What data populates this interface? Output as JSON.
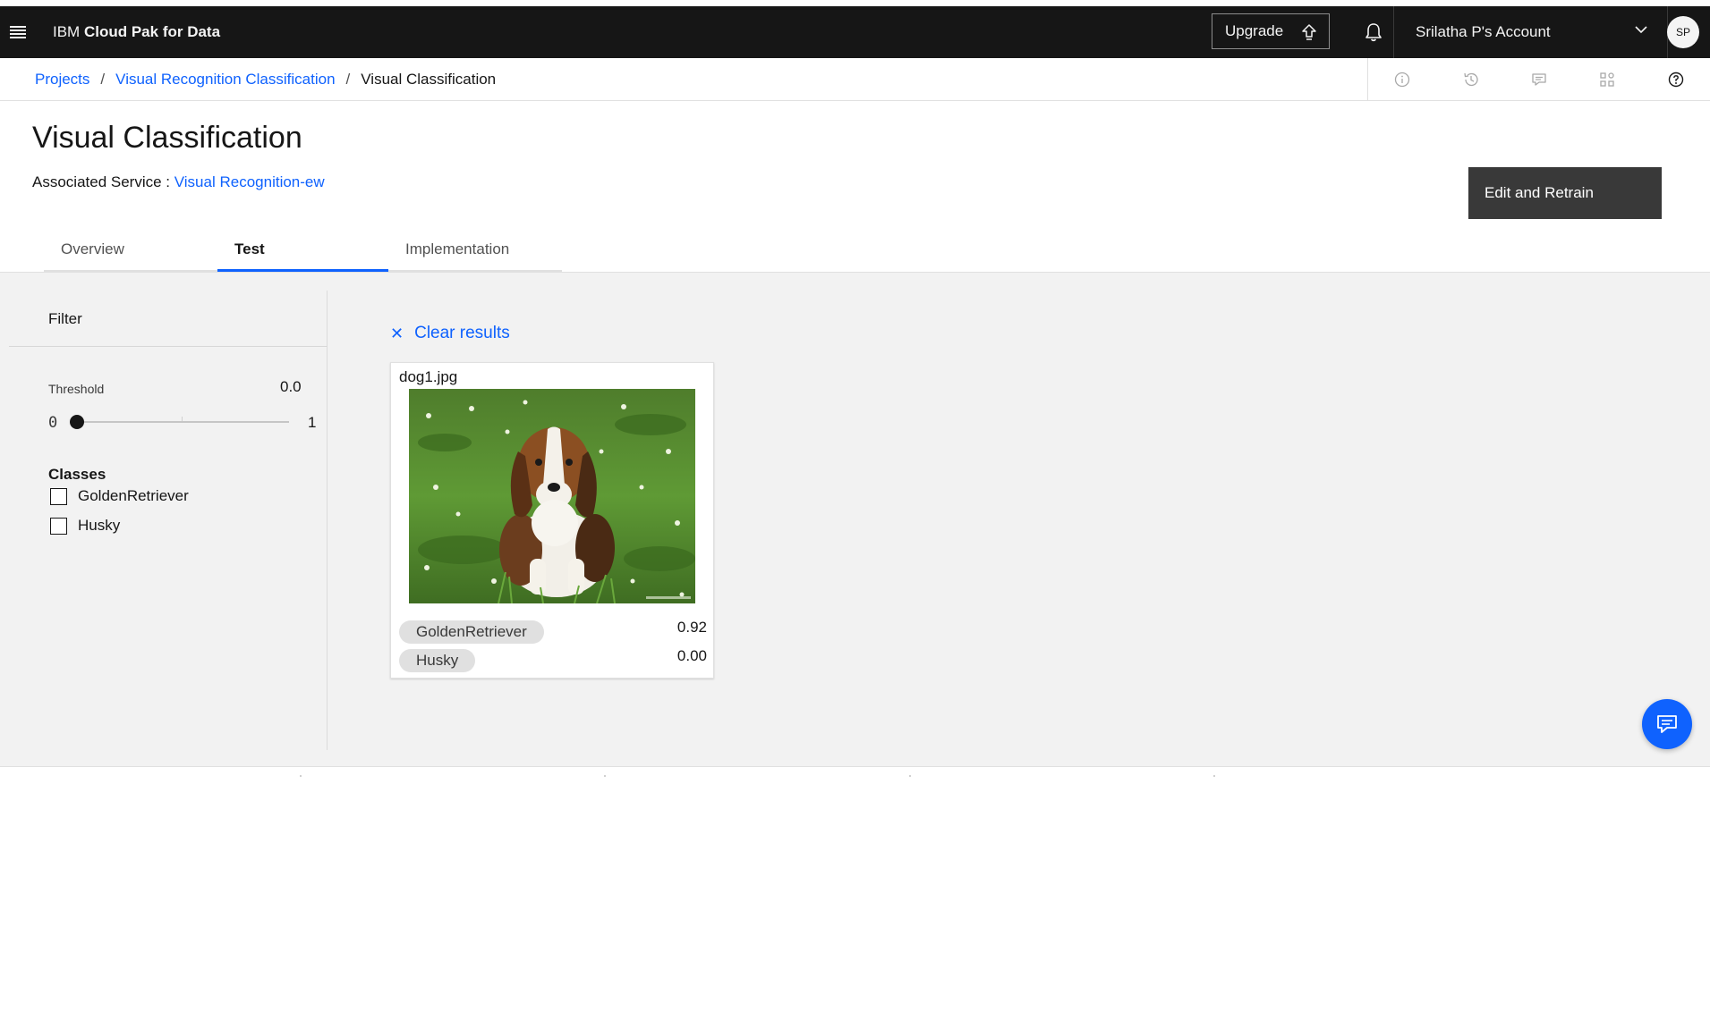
{
  "header": {
    "brand_prefix": "IBM",
    "brand_name": "Cloud Pak for Data",
    "upgrade_label": "Upgrade",
    "account_label": "Srilatha P's Account",
    "avatar_initials": "SP"
  },
  "breadcrumb": {
    "items": [
      "Projects",
      "Visual Recognition Classification"
    ],
    "separator": "/",
    "current": "Visual Classification"
  },
  "page": {
    "title": "Visual Classification",
    "service_label": "Associated Service :",
    "service_link": "Visual Recognition-ew",
    "edit_button": "Edit and Retrain"
  },
  "tabs": [
    {
      "label": "Overview",
      "selected": false
    },
    {
      "label": "Test",
      "selected": true
    },
    {
      "label": "Implementation",
      "selected": false
    }
  ],
  "filter": {
    "title": "Filter",
    "threshold_label": "Threshold",
    "threshold_value": "0.0",
    "threshold_fraction": 0.0,
    "slider_min": "0",
    "slider_max": "1",
    "classes_title": "Classes",
    "classes": [
      {
        "label": "GoldenRetriever",
        "checked": false
      },
      {
        "label": "Husky",
        "checked": false
      }
    ]
  },
  "results": {
    "clear_label": "Clear results",
    "image": {
      "name": "dog1.jpg",
      "scores": [
        {
          "class": "GoldenRetriever",
          "score": "0.92"
        },
        {
          "class": "Husky",
          "score": "0.00"
        }
      ]
    }
  },
  "colors": {
    "accent": "#0f62fe",
    "header_bg": "#161616",
    "test_bg": "#f2f2f2",
    "button_dark": "#393939"
  },
  "icons": {
    "menu": "hamburger-menu-icon",
    "upgrade": "upgrade-arrow-icon",
    "notifications": "bell-icon",
    "account_dropdown": "chevron-down-icon",
    "tools": [
      "info-icon",
      "history-icon",
      "comment-icon",
      "apps-icon",
      "help-icon"
    ],
    "clear": "close-icon",
    "chat": "chat-icon"
  }
}
